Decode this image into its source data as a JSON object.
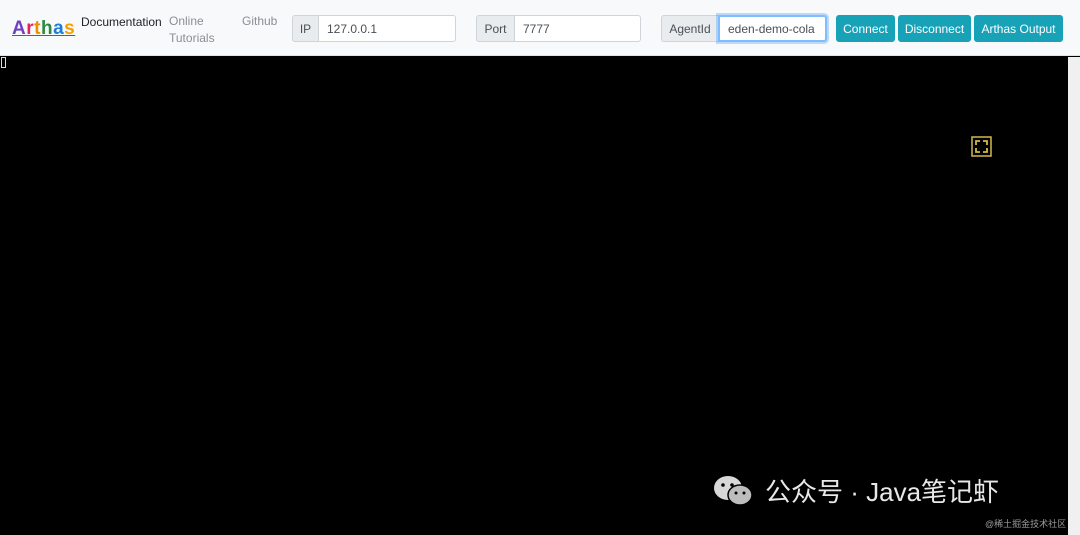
{
  "brand": {
    "letters": [
      "A",
      "r",
      "t",
      "h",
      "a",
      "s"
    ]
  },
  "nav": {
    "documentation": "Documentation",
    "online_tutorials_line1": "Online",
    "online_tutorials_line2": "Tutorials",
    "github": "Github"
  },
  "connection": {
    "ip_label": "IP",
    "ip_value": "127.0.0.1",
    "port_label": "Port",
    "port_value": "7777",
    "agentid_label": "AgentId",
    "agentid_value": "eden-demo-cola"
  },
  "buttons": {
    "connect": "Connect",
    "disconnect": "Disconnect",
    "output": "Arthas Output"
  },
  "colors": {
    "accent": "#17a2b8",
    "terminal_bg": "#000000",
    "fullscreen_icon": "#d4b84a"
  },
  "icons": {
    "fullscreen": "fullscreen-icon",
    "wechat": "wechat-icon"
  },
  "watermark": {
    "text": "公众号 · Java笔记虾",
    "credit": "@稀土掘金技术社区"
  }
}
